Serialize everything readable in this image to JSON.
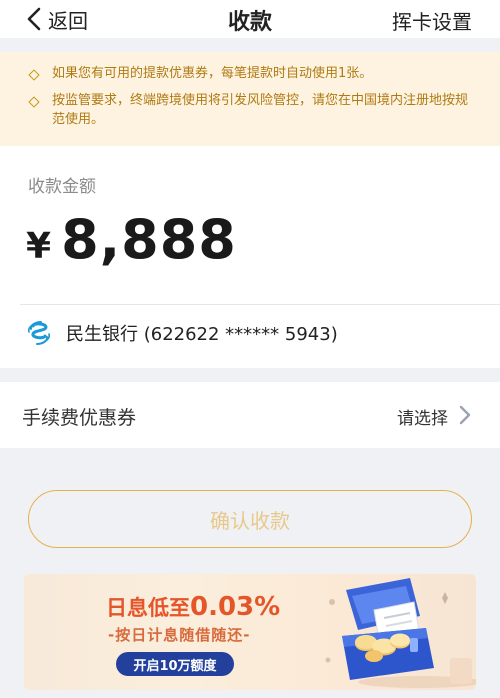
{
  "nav": {
    "back_label": "返回",
    "title": "收款",
    "right_label": "挥卡设置"
  },
  "notices": [
    "如果您有可用的提款优惠券，每笔提款时自动使用1张。",
    "按监管要求，终端跨境使用将引发风险管控，请您在中国境内注册地按规范使用。"
  ],
  "amount": {
    "label": "收款金额",
    "currency": "¥",
    "value": "8,888"
  },
  "bank": {
    "icon": "minsheng-bank-logo",
    "name": "民生银行 (622622 ****** 5943)"
  },
  "coupon": {
    "label": "手续费优惠券",
    "value": "请选择"
  },
  "confirm_label": "确认收款",
  "banner": {
    "headline_prefix": "日息低至",
    "headline_rate": "0.03%",
    "sub": "-按日计息随借随还-",
    "pill": "开启10万额度"
  },
  "colors": {
    "accent": "#e8b04a",
    "notice_text": "#b07a12",
    "notice_bg": "#fdf3e0",
    "banner_red": "#e5552a",
    "banner_pill": "#23419c"
  }
}
